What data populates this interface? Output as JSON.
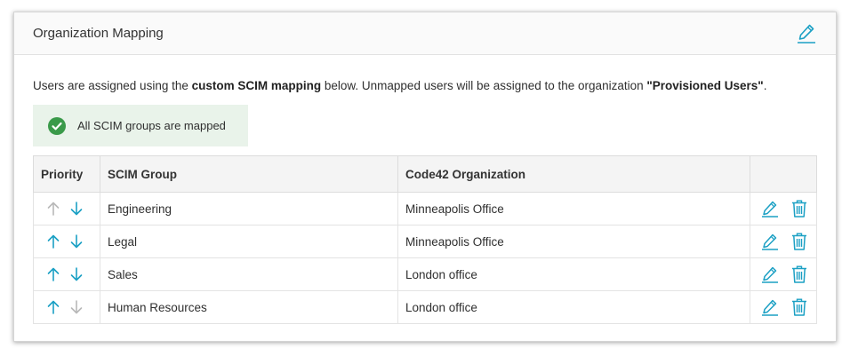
{
  "header": {
    "title": "Organization Mapping",
    "edit_icon": "pencil-icon"
  },
  "description": {
    "part1": "Users are assigned using the ",
    "bold1": "custom SCIM mapping",
    "part2": " below.  Unmapped users will be assigned to the organization ",
    "bold2": "\"Provisioned Users\"",
    "part3": "."
  },
  "status": {
    "icon": "check-circle-icon",
    "text": "All SCIM groups are mapped"
  },
  "table": {
    "columns": [
      "Priority",
      "SCIM Group",
      "Code42 Organization",
      ""
    ],
    "rows": [
      {
        "scim_group": "Engineering",
        "organization": "Minneapolis Office",
        "up_enabled": false,
        "down_enabled": true
      },
      {
        "scim_group": "Legal",
        "organization": "Minneapolis Office",
        "up_enabled": true,
        "down_enabled": true
      },
      {
        "scim_group": "Sales",
        "organization": "London office",
        "up_enabled": true,
        "down_enabled": true
      },
      {
        "scim_group": "Human Resources",
        "organization": "London office",
        "up_enabled": true,
        "down_enabled": false
      }
    ]
  },
  "colors": {
    "accent": "#1ba0c4",
    "disabled": "#b8b8b8",
    "success": "#3a9a4a",
    "banner_bg": "#e9f3ea"
  }
}
